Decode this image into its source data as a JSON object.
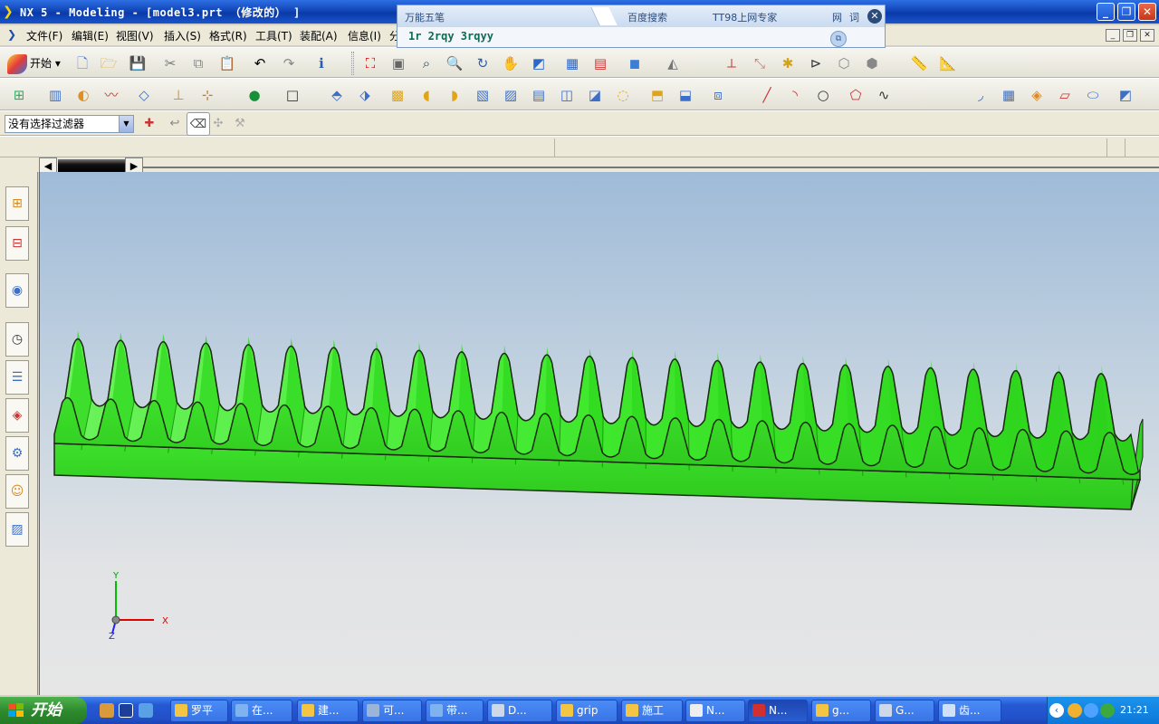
{
  "window": {
    "title": "NX 5 - Modeling - [model3.prt （修改的） ]",
    "controls": {
      "minimize": "_",
      "maximize": "❐",
      "close": "✕"
    }
  },
  "ime_bar": {
    "name": "万能五笔",
    "search": "百度搜索",
    "expert": "TT98上网专家",
    "wang": "网",
    "ci": "词",
    "code_text": "1r 2rqy 3rqyy"
  },
  "menu": {
    "items": [
      "文件(F)",
      "编辑(E)",
      "视图(V)",
      "插入(S)",
      "格式(R)",
      "工具(T)",
      "装配(A)",
      "信息(I)",
      "分"
    ]
  },
  "toolbar": {
    "start_label": "开始",
    "filter_value": "没有选择过滤器"
  },
  "viewport": {
    "model_color": "#33dd22",
    "triad": {
      "x_label": "X",
      "y_label": "Y",
      "z_label": "Z"
    }
  },
  "taskbar": {
    "start_label": "开始",
    "tasks": [
      "罗平",
      "在...",
      "建...",
      "可...",
      "带...",
      "D...",
      "grip",
      "施工",
      "N...",
      "N...",
      "g...",
      "G...",
      "齿..."
    ],
    "clock": "21:21"
  }
}
